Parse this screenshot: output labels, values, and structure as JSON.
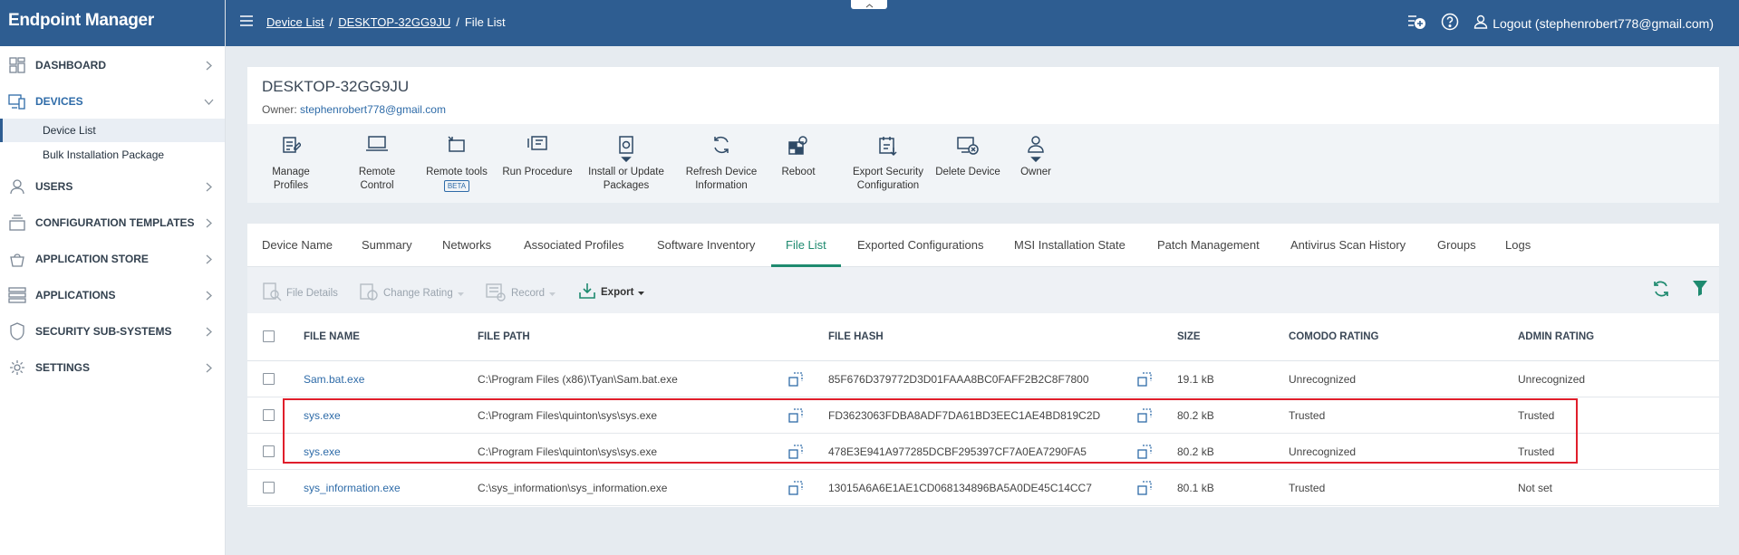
{
  "app": {
    "brand": "Endpoint Manager"
  },
  "sidebar": {
    "items": [
      {
        "label": "DASHBOARD",
        "icon": "dashboard-icon"
      },
      {
        "label": "DEVICES",
        "icon": "devices-icon",
        "expanded": true
      },
      {
        "label": "USERS",
        "icon": "user-icon"
      },
      {
        "label": "CONFIGURATION TEMPLATES",
        "icon": "templates-icon"
      },
      {
        "label": "APPLICATION STORE",
        "icon": "store-icon"
      },
      {
        "label": "APPLICATIONS",
        "icon": "applications-icon"
      },
      {
        "label": "SECURITY SUB-SYSTEMS",
        "icon": "shield-icon"
      },
      {
        "label": "SETTINGS",
        "icon": "gear-icon"
      }
    ],
    "sub_items": [
      {
        "label": "Device List",
        "active": true
      },
      {
        "label": "Bulk Installation Package"
      }
    ]
  },
  "topbar": {
    "breadcrumb": [
      "Device List",
      "DESKTOP-32GG9JU",
      "File List"
    ],
    "separator": "/",
    "logout": "Logout (stephenrobert778@gmail.com)"
  },
  "device": {
    "name": "DESKTOP-32GG9JU",
    "owner_label": "Owner:",
    "owner_email": "stephenrobert778@gmail.com"
  },
  "toolbar": {
    "manage_profiles": "Manage Profiles",
    "remote_control": "Remote Control",
    "remote_tools": "Remote tools",
    "remote_tools_badge": "BETA",
    "run_procedure": "Run Procedure",
    "install_update_1": "Install or Update",
    "install_update_2": "Packages",
    "refresh_1": "Refresh Device",
    "refresh_2": "Information",
    "reboot": "Reboot",
    "export_sec_1": "Export Security",
    "export_sec_2": "Configuration",
    "delete_device": "Delete Device",
    "owner": "Owner"
  },
  "tabs": [
    "Device Name",
    "Summary",
    "Networks",
    "Associated Profiles",
    "Software Inventory",
    "File List",
    "Exported Configurations",
    "MSI Installation State",
    "Patch Management",
    "Antivirus Scan History",
    "Groups",
    "Logs"
  ],
  "active_tab": "File List",
  "actions": {
    "file_details": "File Details",
    "change_rating": "Change Rating",
    "record": "Record",
    "export": "Export"
  },
  "table": {
    "headers": {
      "name": "FILE NAME",
      "path": "FILE PATH",
      "hash": "FILE HASH",
      "size": "SIZE",
      "comodo": "COMODO RATING",
      "admin": "ADMIN RATING"
    },
    "rows": [
      {
        "name": "Sam.bat.exe",
        "path": "C:\\Program Files (x86)\\Tyan\\Sam.bat.exe",
        "hash": "85F676D379772D3D01FAAA8BC0FAFF2B2C8F7800",
        "size": "19.1 kB",
        "comodo": "Unrecognized",
        "admin": "Unrecognized"
      },
      {
        "name": "sys.exe",
        "path": "C:\\Program Files\\quinton\\sys\\sys.exe",
        "hash": "FD3623063FDBA8ADF7DA61BD3EEC1AE4BD819C2D",
        "size": "80.2 kB",
        "comodo": "Trusted",
        "admin": "Trusted"
      },
      {
        "name": "sys.exe",
        "path": "C:\\Program Files\\quinton\\sys\\sys.exe",
        "hash": "478E3E941A977285DCBF295397CF7A0EA7290FA5",
        "size": "80.2 kB",
        "comodo": "Unrecognized",
        "admin": "Trusted"
      },
      {
        "name": "sys_information.exe",
        "path": "C:\\sys_information\\sys_information.exe",
        "hash": "13015A6A6E1AE1CD068134896BA5A0DE45C14CC7",
        "size": "80.1 kB",
        "comodo": "Trusted",
        "admin": "Not set"
      }
    ]
  },
  "colors": {
    "brand": "#2e5d91",
    "accent": "#1e8a6f",
    "link": "#2e6ba8",
    "highlight": "#e01e2b"
  }
}
